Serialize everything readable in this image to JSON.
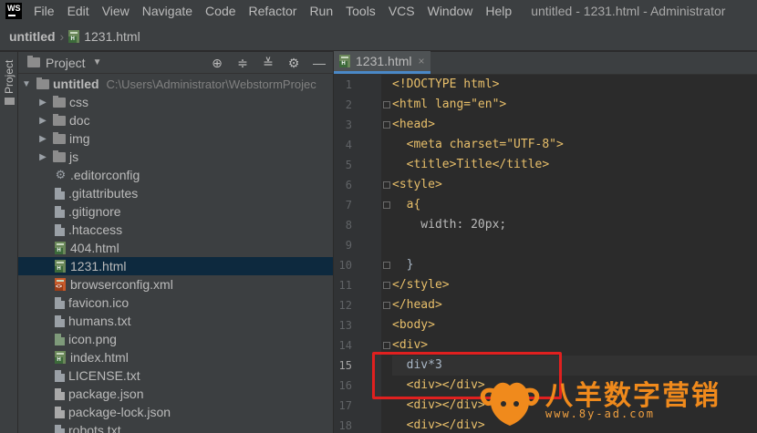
{
  "app": {
    "logo_text": "WS",
    "menu": [
      "File",
      "Edit",
      "View",
      "Navigate",
      "Code",
      "Refactor",
      "Run",
      "Tools",
      "VCS",
      "Window",
      "Help"
    ],
    "window_title": "untitled - 1231.html - Administrator"
  },
  "breadcrumb": {
    "project": "untitled",
    "separator": "›",
    "file": "1231.html"
  },
  "toolstrip": {
    "label": "Project"
  },
  "project_panel": {
    "title": "Project",
    "root": {
      "name": "untitled",
      "path": "C:\\Users\\Administrator\\WebstormProjec"
    },
    "items": [
      {
        "name": "css",
        "type": "folder"
      },
      {
        "name": "doc",
        "type": "folder"
      },
      {
        "name": "img",
        "type": "folder"
      },
      {
        "name": "js",
        "type": "folder"
      },
      {
        "name": ".editorconfig",
        "type": "config"
      },
      {
        "name": ".gitattributes",
        "type": "file"
      },
      {
        "name": ".gitignore",
        "type": "file"
      },
      {
        "name": ".htaccess",
        "type": "file"
      },
      {
        "name": "404.html",
        "type": "html"
      },
      {
        "name": "1231.html",
        "type": "html",
        "selected": true
      },
      {
        "name": "browserconfig.xml",
        "type": "xml"
      },
      {
        "name": "favicon.ico",
        "type": "file"
      },
      {
        "name": "humans.txt",
        "type": "file"
      },
      {
        "name": "icon.png",
        "type": "image"
      },
      {
        "name": "index.html",
        "type": "html"
      },
      {
        "name": "LICENSE.txt",
        "type": "file"
      },
      {
        "name": "package.json",
        "type": "json"
      },
      {
        "name": "package-lock.json",
        "type": "json"
      },
      {
        "name": "robots.txt",
        "type": "file"
      }
    ]
  },
  "editor": {
    "tab": {
      "label": "1231.html",
      "close": "×"
    },
    "current_line": 15,
    "lines": [
      {
        "n": "1",
        "t": "<!DOCTYPE html>"
      },
      {
        "n": "2",
        "t": "<html lang=\"en\">"
      },
      {
        "n": "3",
        "t": "<head>"
      },
      {
        "n": "4",
        "t": "  <meta charset=\"UTF-8\">"
      },
      {
        "n": "5",
        "t": "  <title>Title</title>"
      },
      {
        "n": "6",
        "t": "<style>"
      },
      {
        "n": "7",
        "t": "  a{"
      },
      {
        "n": "8",
        "t": "    width: 20px;"
      },
      {
        "n": "9",
        "t": ""
      },
      {
        "n": "10",
        "t": "  }"
      },
      {
        "n": "11",
        "t": "</style>"
      },
      {
        "n": "12",
        "t": "</head>"
      },
      {
        "n": "13",
        "t": "<body>"
      },
      {
        "n": "14",
        "t": "<div>"
      },
      {
        "n": "15",
        "t": "  div*3"
      },
      {
        "n": "16",
        "t": "  <div></div>"
      },
      {
        "n": "17",
        "t": "  <div></div>"
      },
      {
        "n": "18",
        "t": "  <div></div>"
      }
    ]
  },
  "watermark": {
    "text": "八羊数字营销",
    "url": "www.8y-ad.com"
  },
  "colors": {
    "highlight_box": "#e0201f",
    "watermark": "#f08a1c",
    "selection": "#0d293e",
    "tab_underline": "#4a88c7"
  }
}
